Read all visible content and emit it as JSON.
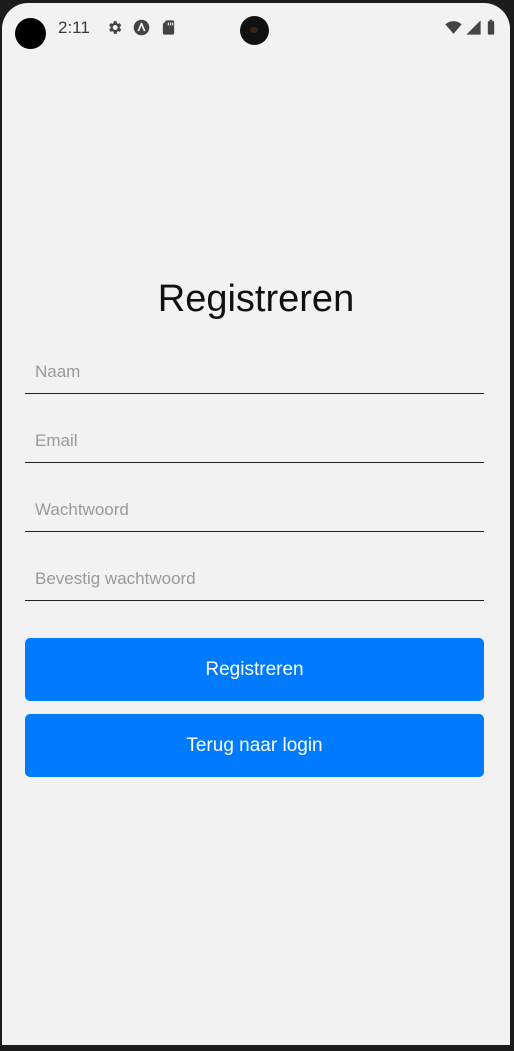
{
  "status_bar": {
    "time": "2:11",
    "icons": [
      "gear-icon",
      "app-a-icon",
      "sd-card-icon",
      "wifi-icon",
      "signal-icon",
      "battery-icon"
    ]
  },
  "form": {
    "title": "Registreren",
    "fields": [
      {
        "placeholder": "Naam",
        "value": ""
      },
      {
        "placeholder": "Email",
        "value": ""
      },
      {
        "placeholder": "Wachtwoord",
        "value": ""
      },
      {
        "placeholder": "Bevestig wachtwoord",
        "value": ""
      }
    ],
    "register_label": "Registreren",
    "back_label": "Terug naar login"
  },
  "colors": {
    "background": "#f2f2f2",
    "button": "#007bff",
    "button_text": "#ffffff"
  }
}
